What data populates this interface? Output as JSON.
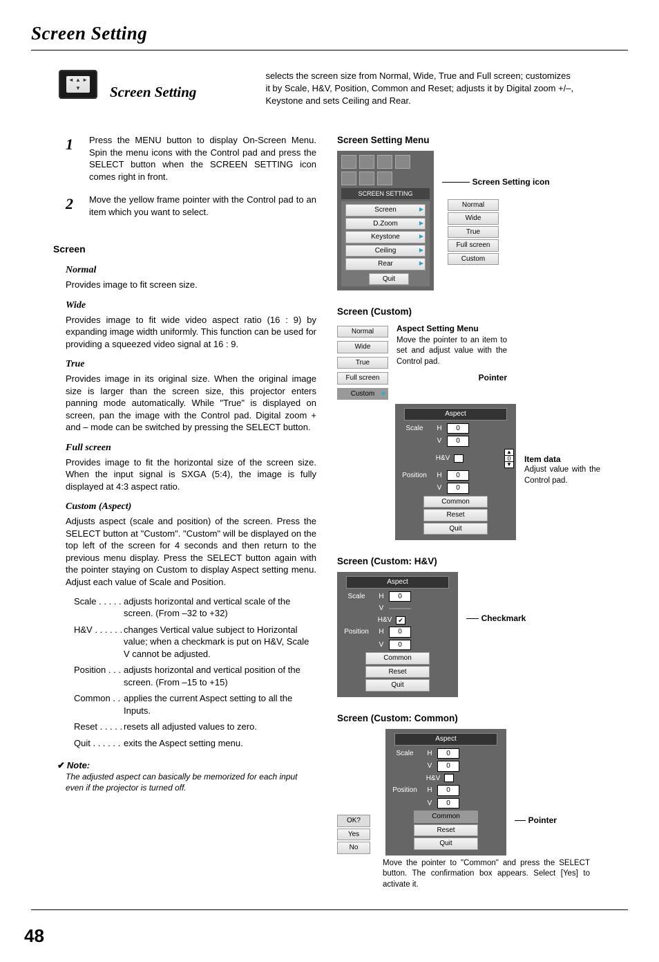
{
  "page_title": "Screen Setting",
  "intro_heading": "Screen Setting",
  "intro_desc": "selects the screen size from Normal, Wide, True and Full screen; customizes it by Scale, H&V, Position, Common and Reset; adjusts it by Digital zoom +/–, Keystone and sets Ceiling and Rear.",
  "steps": [
    {
      "num": "1",
      "text": "Press the MENU button to display On-Screen Menu.  Spin the menu icons with the Control pad and press the SELECT button when the SCREEN SETTING icon comes right in front."
    },
    {
      "num": "2",
      "text": "Move the yellow frame pointer with the Control pad to an item which you want to select."
    }
  ],
  "screen_section_title": "Screen",
  "modes": {
    "normal": {
      "title": "Normal",
      "text": "Provides image to fit screen size."
    },
    "wide": {
      "title": "Wide",
      "text": "Provides image to fit wide video aspect ratio (16 : 9) by expanding image width uniformly.  This function can be used for providing a squeezed video signal at 16 : 9."
    },
    "true": {
      "title": "True",
      "text": "Provides image in its original size.  When the original image size is larger than the screen size, this projector enters panning mode automatically.  While \"True\" is displayed on screen, pan the image with the Control pad.  Digital zoom + and – mode can be switched by pressing the SELECT button."
    },
    "full": {
      "title": "Full screen",
      "text": "Provides image to fit the horizontal size of the screen size. When the input signal is SXGA (5:4), the image is fully displayed at 4:3 aspect ratio."
    },
    "custom": {
      "title": "Custom (Aspect)",
      "text": "Adjusts aspect (scale and position) of the screen.  Press the SELECT button at \"Custom\".  \"Custom\" will be displayed on the top left of the screen for 4 seconds and then return to the previous menu display.  Press the SELECT button again with the pointer staying on Custom to display Aspect setting menu.  Adjust each value of Scale and Position."
    }
  },
  "params": [
    {
      "label": "Scale",
      "dots": ". . . . .",
      "desc": "adjusts horizontal and vertical scale of the screen. (From –32 to +32)"
    },
    {
      "label": "H&V",
      "dots": ". . . . . .",
      "desc": "changes Vertical value subject to Horizontal value; when a checkmark is put on H&V, Scale V cannot be adjusted."
    },
    {
      "label": "Position",
      "dots": ". . .",
      "desc": "adjusts horizontal and vertical position of the screen.  (From –15 to +15)"
    },
    {
      "label": "Common",
      "dots": ". .",
      "desc": "applies the current Aspect setting to all the Inputs."
    },
    {
      "label": "Reset",
      "dots": ". . . . .",
      "desc": "resets all adjusted values to zero."
    },
    {
      "label": "Quit",
      "dots": ". . . . . .",
      "desc": "exits the Aspect setting menu."
    }
  ],
  "note_header": "Note:",
  "note_text": "The adjusted aspect can basically be memorized for each input even if the projector is turned off.",
  "fig1": {
    "title": "Screen Setting Menu",
    "caption": "SCREEN SETTING",
    "items": [
      "Screen",
      "D.Zoom",
      "Keystone",
      "Ceiling",
      "Rear"
    ],
    "quit": "Quit",
    "submenu": [
      "Normal",
      "Wide",
      "True",
      "Full screen",
      "Custom"
    ],
    "callout_title": "Screen Setting icon"
  },
  "fig2": {
    "title": "Screen (Custom)",
    "list": [
      "Normal",
      "Wide",
      "True",
      "Full screen",
      "Custom"
    ],
    "aspect_header": "Aspect",
    "rows_scale": "Scale",
    "rows_pos": "Position",
    "h": "H",
    "v": "V",
    "hv": "H&V",
    "val": "0",
    "buttons": [
      "Common",
      "Reset",
      "Quit"
    ],
    "callout1_title": "Aspect Setting Menu",
    "callout1_text": "Move the pointer to an item to set and adjust value with the Control pad.",
    "callout_pointer": "Pointer",
    "callout_item_title": "Item data",
    "callout_item_text": "Adjust value with the Control pad."
  },
  "fig3": {
    "title": "Screen (Custom: H&V)",
    "callout": "Checkmark"
  },
  "fig4": {
    "title": "Screen (Custom: Common)",
    "confirm": {
      "hdr": "OK?",
      "yes": "Yes",
      "no": "No"
    },
    "callout": "Pointer",
    "text": "Move the pointer to \"Common\" and press the SELECT button. The confirmation box appears. Select [Yes] to activate it."
  },
  "page_number": "48"
}
